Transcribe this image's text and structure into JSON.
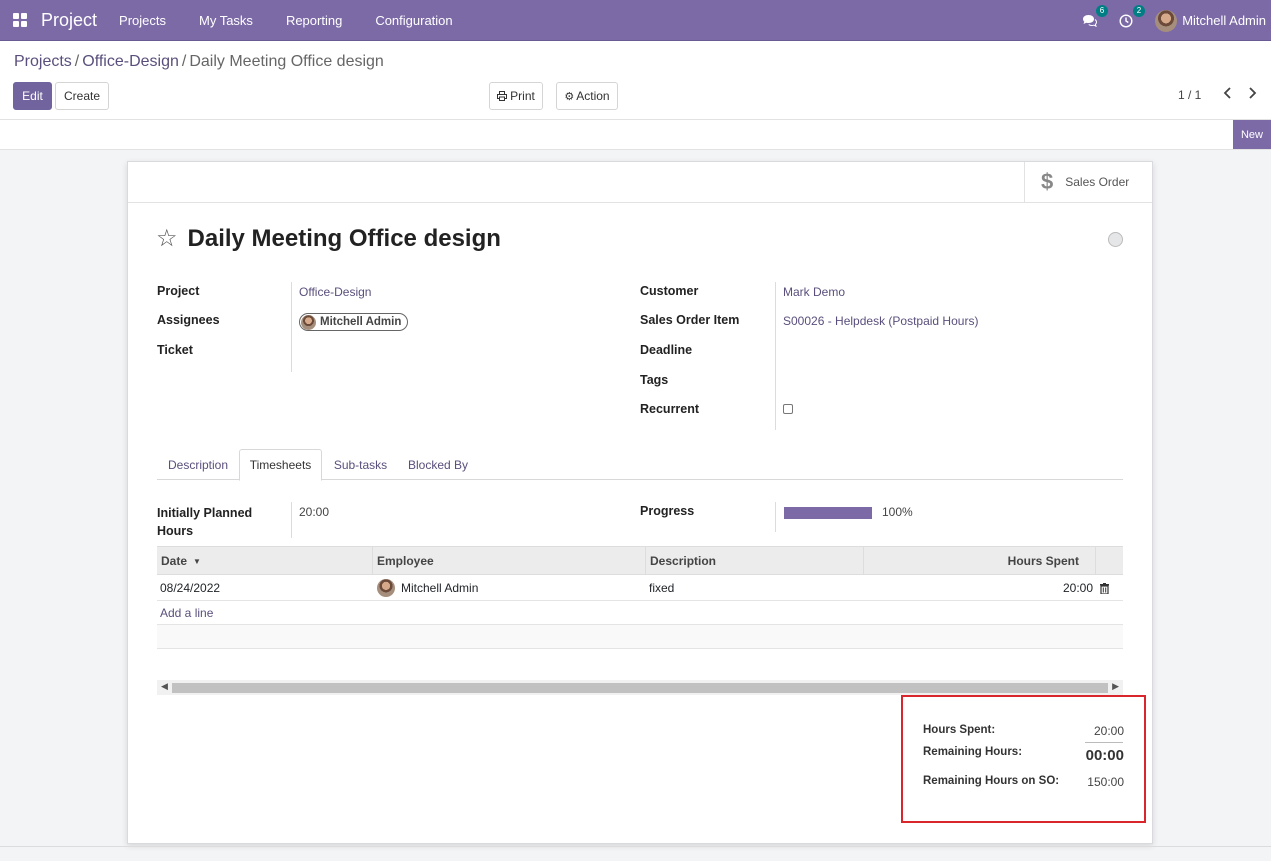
{
  "navbar": {
    "app_title": "Project",
    "menu": [
      "Projects",
      "My Tasks",
      "Reporting",
      "Configuration"
    ],
    "messages_count": "6",
    "activities_count": "2",
    "user_name": "Mitchell Admin",
    "brand_color": "#7c6aa7"
  },
  "breadcrumb": {
    "items": [
      "Projects",
      "Office-Design"
    ],
    "current": "Daily Meeting Office design"
  },
  "toolbar": {
    "edit": "Edit",
    "create": "Create",
    "print": "Print",
    "action": "Action",
    "pager": "1 / 1"
  },
  "status": {
    "stage": "New"
  },
  "smart_button": {
    "label": "Sales Order",
    "icon": "dollar-icon"
  },
  "task": {
    "title": "Daily Meeting Office design",
    "left_fields": {
      "project_label": "Project",
      "project_value": "Office-Design",
      "assignees_label": "Assignees",
      "assignee": "Mitchell Admin",
      "ticket_label": "Ticket"
    },
    "right_fields": {
      "customer_label": "Customer",
      "customer_value": "Mark Demo",
      "so_item_label": "Sales Order Item",
      "so_item_value": "S00026 - Helpdesk (Postpaid Hours)",
      "deadline_label": "Deadline",
      "tags_label": "Tags",
      "recurrent_label": "Recurrent"
    }
  },
  "tabs": [
    "Description",
    "Timesheets",
    "Sub-tasks",
    "Blocked By"
  ],
  "timesheets": {
    "planned_label_1": "Initially Planned",
    "planned_label_2": "Hours",
    "planned_value": "20:00",
    "progress_label": "Progress",
    "progress_value": "100%",
    "progress_fraction": 1.0,
    "columns": {
      "date": "Date",
      "employee": "Employee",
      "description": "Description",
      "hours": "Hours Spent"
    },
    "rows": [
      {
        "date": "08/24/2022",
        "employee": "Mitchell Admin",
        "description": "fixed",
        "hours": "20:00"
      }
    ],
    "add_line": "Add a line"
  },
  "totals": {
    "hours_spent_label": "Hours Spent:",
    "hours_spent": "20:00",
    "remaining_label": "Remaining Hours:",
    "remaining": "00:00",
    "remaining_so_label": "Remaining Hours on SO:",
    "remaining_so": "150:00"
  }
}
